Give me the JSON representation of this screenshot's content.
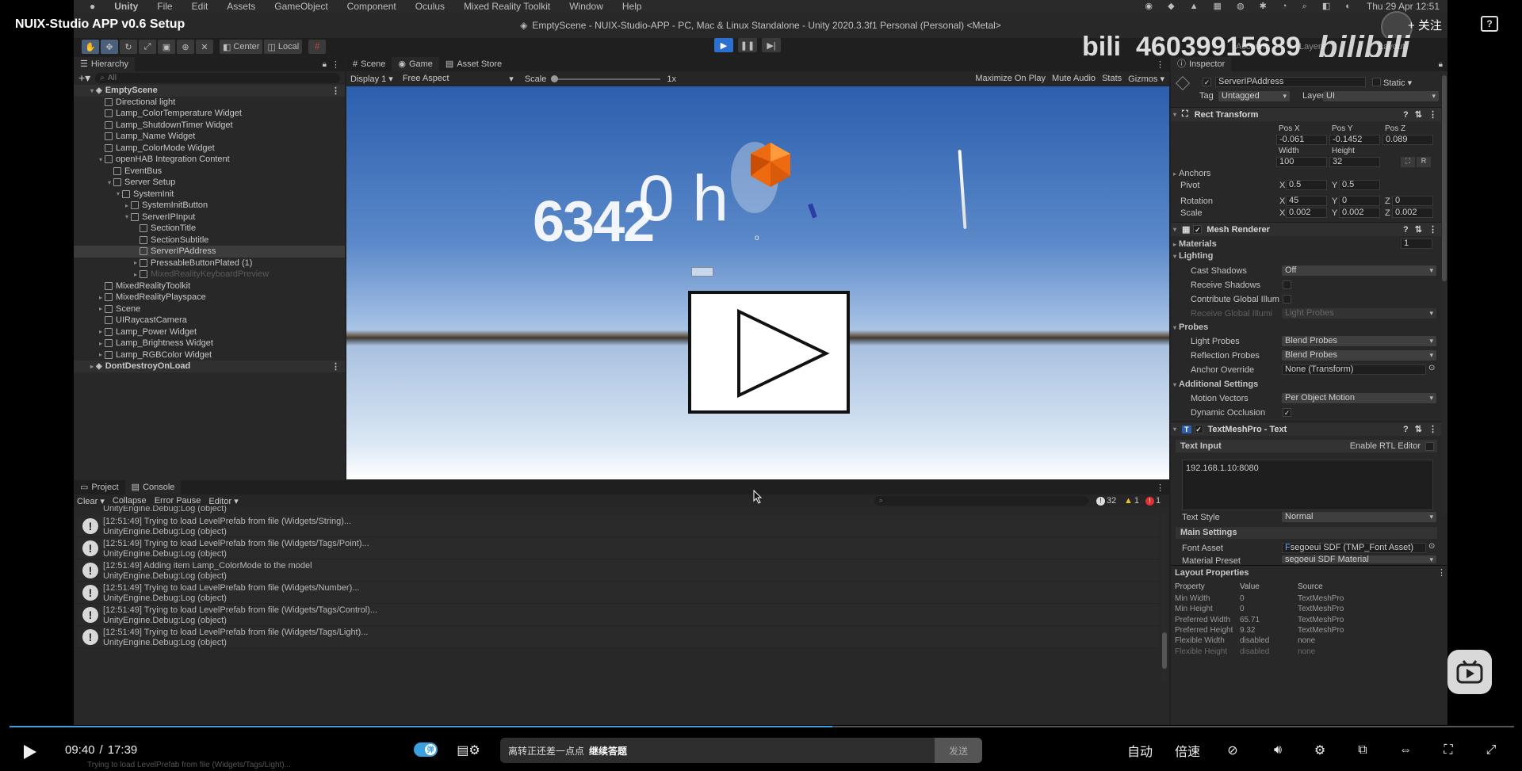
{
  "video": {
    "title": "NUIX-Studio APP v0.6 Setup",
    "follow_label": "+ 关注",
    "watermark_text": "bili_4603991568​9",
    "watermark_logo": "bilibili",
    "current_time": "09:40",
    "time_sep": "/",
    "total_time": "17:39",
    "progress_fraction": 0.547,
    "danmaku_placeholder": "离转正还差一点点",
    "danmaku_hint": "继续答题",
    "send_label": "发送",
    "auto_label": "自动",
    "speed_label": "倍速",
    "subtitle_text": "Trying to load LevelPrefab from file (Widgets/Tags/Light)..."
  },
  "macmenu": {
    "apple": "",
    "items": [
      "Unity",
      "File",
      "Edit",
      "Assets",
      "GameObject",
      "Component",
      "Oculus",
      "Mixed Reality Toolkit",
      "Window",
      "Help"
    ],
    "clock": "Thu 29 Apr  12:51"
  },
  "unity": {
    "window_title": "EmptyScene - NUIX-Studio-APP - PC, Mac & Linux Standalone - Unity 2020.3.3f1 Personal (Personal) <Metal>",
    "toolbar": {
      "center": "Center",
      "local": "Local",
      "account": "Account",
      "layers": "Layers",
      "layout": "Layout"
    },
    "hierarchy": {
      "tab": "Hierarchy",
      "search_placeholder": "All",
      "rows": [
        {
          "label": "EmptyScene",
          "depth": 0,
          "arrow": "▾",
          "kind": "scene",
          "state": "scene"
        },
        {
          "label": "Directional light",
          "depth": 1,
          "arrow": "",
          "kind": "obj",
          "state": ""
        },
        {
          "label": "Lamp_ColorTemperature Widget",
          "depth": 1,
          "arrow": "",
          "kind": "obj",
          "state": ""
        },
        {
          "label": "Lamp_ShutdownTimer Widget",
          "depth": 1,
          "arrow": "",
          "kind": "obj",
          "state": ""
        },
        {
          "label": "Lamp_Name Widget",
          "depth": 1,
          "arrow": "",
          "kind": "obj",
          "state": ""
        },
        {
          "label": "Lamp_ColorMode Widget",
          "depth": 1,
          "arrow": "",
          "kind": "obj",
          "state": ""
        },
        {
          "label": "openHAB Integration Content",
          "depth": 1,
          "arrow": "▾",
          "kind": "obj",
          "state": ""
        },
        {
          "label": "EventBus",
          "depth": 2,
          "arrow": "",
          "kind": "obj",
          "state": ""
        },
        {
          "label": "Server Setup",
          "depth": 2,
          "arrow": "▾",
          "kind": "obj",
          "state": ""
        },
        {
          "label": "SystemInit",
          "depth": 3,
          "arrow": "▾",
          "kind": "obj",
          "state": ""
        },
        {
          "label": "SystemInitButton",
          "depth": 4,
          "arrow": "▸",
          "kind": "obj",
          "state": ""
        },
        {
          "label": "ServerIPInput",
          "depth": 4,
          "arrow": "▾",
          "kind": "obj",
          "state": ""
        },
        {
          "label": "SectionTitle",
          "depth": 5,
          "arrow": "",
          "kind": "obj",
          "state": ""
        },
        {
          "label": "SectionSubtitle",
          "depth": 5,
          "arrow": "",
          "kind": "obj",
          "state": ""
        },
        {
          "label": "ServerIPAddress",
          "depth": 5,
          "arrow": "",
          "kind": "obj",
          "state": "sel"
        },
        {
          "label": "PressableButtonPlated (1)",
          "depth": 5,
          "arrow": "▸",
          "kind": "obj",
          "state": ""
        },
        {
          "label": "MixedRealityKeyboardPreview",
          "depth": 5,
          "arrow": "▸",
          "kind": "obj",
          "state": "dim"
        },
        {
          "label": "MixedRealityToolkit",
          "depth": 1,
          "arrow": "",
          "kind": "obj",
          "state": ""
        },
        {
          "label": "MixedRealityPlayspace",
          "depth": 1,
          "arrow": "▸",
          "kind": "obj",
          "state": ""
        },
        {
          "label": "Scene",
          "depth": 1,
          "arrow": "▸",
          "kind": "obj",
          "state": ""
        },
        {
          "label": "UIRaycastCamera",
          "depth": 1,
          "arrow": "",
          "kind": "obj",
          "state": ""
        },
        {
          "label": "Lamp_Power Widget",
          "depth": 1,
          "arrow": "▸",
          "kind": "obj",
          "state": ""
        },
        {
          "label": "Lamp_Brightness Widget",
          "depth": 1,
          "arrow": "▸",
          "kind": "obj",
          "state": ""
        },
        {
          "label": "Lamp_RGBColor Widget",
          "depth": 1,
          "arrow": "▸",
          "kind": "obj",
          "state": ""
        },
        {
          "label": "DontDestroyOnLoad",
          "depth": 0,
          "arrow": "▸",
          "kind": "scene",
          "state": "scene"
        }
      ]
    },
    "center_tabs": [
      "Scene",
      "Game",
      "Asset Store"
    ],
    "game_bar": {
      "display": "Display 1",
      "aspect": "Free Aspect",
      "scale_label": "Scale",
      "scale_value": "1x",
      "maximize": "Maximize On Play",
      "mute": "Mute Audio",
      "stats": "Stats",
      "gizmos": "Gizmos"
    },
    "game_scene_text": {
      "big": "6342",
      "big2": "0 h",
      "small": "o"
    },
    "bottom_tabs": [
      "Project",
      "Console"
    ],
    "console_bar": {
      "clear": "Clear",
      "collapse": "Collapse",
      "error_pause": "Error Pause",
      "editor": "Editor",
      "count_log": "32",
      "count_warn": "1",
      "count_err": "1"
    },
    "console_cut": "UnityEngine.Debug:Log (object)",
    "console_rows": [
      {
        "line1": "[12:51:49] Trying to load LevelPrefab from file (Widgets/String)...",
        "line2": "UnityEngine.Debug:Log (object)"
      },
      {
        "line1": "[12:51:49] Trying to load LevelPrefab from file (Widgets/Tags/Point)...",
        "line2": "UnityEngine.Debug:Log (object)"
      },
      {
        "line1": "[12:51:49] Adding item Lamp_ColorMode to the model",
        "line2": "UnityEngine.Debug:Log (object)"
      },
      {
        "line1": "[12:51:49] Trying to load LevelPrefab from file (Widgets/Number)...",
        "line2": "UnityEngine.Debug:Log (object)"
      },
      {
        "line1": "[12:51:49] Trying to load LevelPrefab from file (Widgets/Tags/Control)...",
        "line2": "UnityEngine.Debug:Log (object)"
      },
      {
        "line1": "[12:51:49] Trying to load LevelPrefab from file (Widgets/Tags/Light)...",
        "line2": "UnityEngine.Debug:Log (object)"
      }
    ],
    "inspector": {
      "tab": "Inspector",
      "object_name": "ServerIPAddress",
      "static": "Static",
      "tag_label": "Tag",
      "tag_value": "Untagged",
      "layer_label": "Layer",
      "layer_value": "UI",
      "rect": {
        "title": "Rect Transform",
        "posx_label": "Pos X",
        "posy_label": "Pos Y",
        "posz_label": "Pos Z",
        "posx": "-0.061",
        "posy": "-0.1452",
        "posz": "0.089",
        "width_label": "Width",
        "height_label": "Height",
        "width": "100",
        "height": "32",
        "anchors": "Anchors",
        "pivot": "Pivot",
        "pivot_x": "0.5",
        "pivot_y": "0.5",
        "rotation": "Rotation",
        "rot_x": "45",
        "rot_y": "0",
        "rot_z": "0",
        "scale": "Scale",
        "scale_x": "0.002",
        "scale_y": "0.002",
        "scale_z": "0.002",
        "x": "X",
        "y": "Y",
        "z": "Z",
        "r": "R"
      },
      "mesh": {
        "title": "Mesh Renderer",
        "materials": "Materials",
        "materials_count": "1",
        "lighting": "Lighting",
        "cast_shadows": "Cast Shadows",
        "cast_shadows_value": "Off",
        "receive_shadows": "Receive Shadows",
        "contribute_gi": "Contribute Global Illum",
        "receive_gi": "Receive Global Illumi",
        "receive_gi_value": "Light Probes",
        "probes": "Probes",
        "light_probes": "Light Probes",
        "light_probes_value": "Blend Probes",
        "reflection_probes": "Reflection Probes",
        "reflection_probes_value": "Blend Probes",
        "anchor_override": "Anchor Override",
        "anchor_override_value": "None (Transform)",
        "additional": "Additional Settings",
        "motion_vectors": "Motion Vectors",
        "motion_vectors_value": "Per Object Motion",
        "dynamic_occlusion": "Dynamic Occlusion"
      },
      "tmp": {
        "title": "TextMeshPro - Text",
        "text_input": "Text Input",
        "rtl": "Enable RTL Editor",
        "text_value": "192.168.1.10:8080",
        "text_style": "Text Style",
        "text_style_value": "Normal",
        "main_settings": "Main Settings",
        "font_asset": "Font Asset",
        "font_asset_value": "segoeui SDF (TMP_Font Asset)",
        "material_preset": "Material Preset",
        "material_preset_value": "segoeui SDF Material"
      },
      "layout": {
        "title": "Layout Properties",
        "headers": [
          "Property",
          "Value",
          "Source"
        ],
        "rows": [
          [
            "Min Width",
            "0",
            "TextMeshPro"
          ],
          [
            "Min Height",
            "0",
            "TextMeshPro"
          ],
          [
            "Preferred Width",
            "65.71",
            "TextMeshPro"
          ],
          [
            "Preferred Height",
            "9.32",
            "TextMeshPro"
          ],
          [
            "Flexible Width",
            "disabled",
            "none"
          ],
          [
            "Flexible Height",
            "disabled",
            "none"
          ]
        ]
      }
    }
  }
}
